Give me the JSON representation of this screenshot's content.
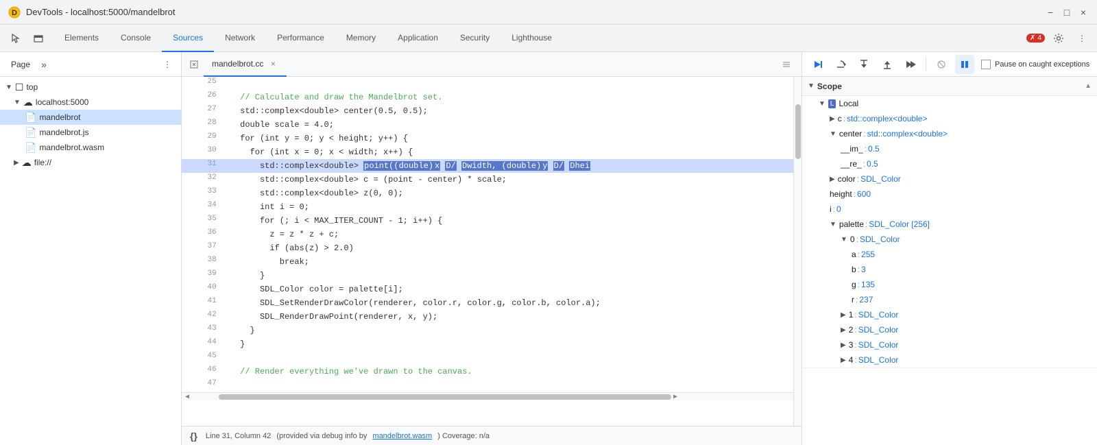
{
  "titleBar": {
    "title": "DevTools - localhost:5000/mandelbrot",
    "minimizeLabel": "minimize",
    "maximizeLabel": "maximize",
    "closeLabel": "close"
  },
  "tabs": {
    "items": [
      {
        "label": "Elements",
        "active": false
      },
      {
        "label": "Console",
        "active": false
      },
      {
        "label": "Sources",
        "active": true
      },
      {
        "label": "Network",
        "active": false
      },
      {
        "label": "Performance",
        "active": false
      },
      {
        "label": "Memory",
        "active": false
      },
      {
        "label": "Application",
        "active": false
      },
      {
        "label": "Security",
        "active": false
      },
      {
        "label": "Lighthouse",
        "active": false
      }
    ],
    "errorCount": "4",
    "moreLabel": "»"
  },
  "leftPanel": {
    "pageTabLabel": "Page",
    "moreLabel": "»",
    "topLabel": "top",
    "localhostLabel": "localhost:5000",
    "files": [
      {
        "name": "mandelbrot",
        "type": "cpp",
        "selected": true
      },
      {
        "name": "mandelbrot.js",
        "type": "js"
      },
      {
        "name": "mandelbrot.wasm",
        "type": "wasm"
      },
      {
        "name": "file://",
        "type": "folder"
      }
    ]
  },
  "editor": {
    "tabName": "mandelbrot.cc",
    "lines": [
      {
        "num": 25,
        "code": ""
      },
      {
        "num": 26,
        "code": "  // Calculate and draw the Mandelbrot set.",
        "isComment": true
      },
      {
        "num": 27,
        "code": "  std::complex<double> center(0.5, 0.5);"
      },
      {
        "num": 28,
        "code": "  double scale = 4.0;"
      },
      {
        "num": 29,
        "code": "  for (int y = 0; y < height; y++) {"
      },
      {
        "num": 30,
        "code": "    for (int x = 0; x < width; x++) {"
      },
      {
        "num": 31,
        "code": "      std::complex<double> point((double)x / width, (double)y / hei",
        "highlighted": true
      },
      {
        "num": 32,
        "code": "      std::complex<double> c = (point - center) * scale;"
      },
      {
        "num": 33,
        "code": "      std::complex<double> z(0, 0);"
      },
      {
        "num": 34,
        "code": "      int i = 0;"
      },
      {
        "num": 35,
        "code": "      for (; i < MAX_ITER_COUNT - 1; i++) {"
      },
      {
        "num": 36,
        "code": "        z = z * z + c;"
      },
      {
        "num": 37,
        "code": "        if (abs(z) > 2.0)"
      },
      {
        "num": 38,
        "code": "          break;"
      },
      {
        "num": 39,
        "code": "      }"
      },
      {
        "num": 40,
        "code": "      SDL_Color color = palette[i];"
      },
      {
        "num": 41,
        "code": "      SDL_SetRenderDrawColor(renderer, color.r, color.g, color.b, color.a);"
      },
      {
        "num": 42,
        "code": "      SDL_RenderDrawPoint(renderer, x, y);"
      },
      {
        "num": 43,
        "code": "    }"
      },
      {
        "num": 44,
        "code": "  }"
      },
      {
        "num": 45,
        "code": ""
      },
      {
        "num": 46,
        "code": "  // Render everything we've drawn to the canvas.",
        "isComment": true
      },
      {
        "num": 47,
        "code": ""
      }
    ],
    "statusBar": {
      "line": "Line 31, Column 42",
      "sourceInfo": "(provided via debug info by",
      "sourceLink": "mandelbrot.wasm",
      "coverageLabel": ") Coverage: n/a"
    }
  },
  "rightPanel": {
    "pauseExceptionsLabel": "Pause on caught exceptions",
    "scopeLabel": "Scope",
    "localLabel": "Local",
    "scopeItems": [
      {
        "key": "c",
        "val": "std::complex<double>",
        "indent": 2,
        "expand": true,
        "collapsed": true
      },
      {
        "key": "center",
        "val": "std::complex<double>",
        "indent": 2,
        "expand": true,
        "collapsed": false
      },
      {
        "key": "__im_",
        "val": "0.5",
        "indent": 3,
        "isNum": true
      },
      {
        "key": "__re_",
        "val": "0.5",
        "indent": 3,
        "isNum": true
      },
      {
        "key": "color",
        "val": "SDL_Color",
        "indent": 2,
        "expand": true,
        "collapsed": true
      },
      {
        "key": "height",
        "val": "600",
        "indent": 2,
        "isNum": true
      },
      {
        "key": "i",
        "val": "0",
        "indent": 2,
        "isNum": true
      },
      {
        "key": "palette",
        "val": "SDL_Color [256]",
        "indent": 2,
        "expand": true,
        "collapsed": false
      },
      {
        "key": "0",
        "val": "SDL_Color",
        "indent": 3,
        "expand": true,
        "collapsed": false
      },
      {
        "key": "a",
        "val": "255",
        "indent": 4,
        "isNum": true
      },
      {
        "key": "b",
        "val": "3",
        "indent": 4,
        "isNum": true
      },
      {
        "key": "g",
        "val": "135",
        "indent": 4,
        "isNum": true
      },
      {
        "key": "r",
        "val": "237",
        "indent": 4,
        "isNum": true
      },
      {
        "key": "1",
        "val": "SDL_Color",
        "indent": 3,
        "expand": true,
        "collapsed": true
      },
      {
        "key": "2",
        "val": "SDL_Color",
        "indent": 3,
        "expand": true,
        "collapsed": true
      },
      {
        "key": "3",
        "val": "SDL_Color",
        "indent": 3,
        "expand": true,
        "collapsed": true
      },
      {
        "key": "4",
        "val": "SDL_Color",
        "indent": 3,
        "expand": true,
        "collapsed": true
      }
    ]
  }
}
